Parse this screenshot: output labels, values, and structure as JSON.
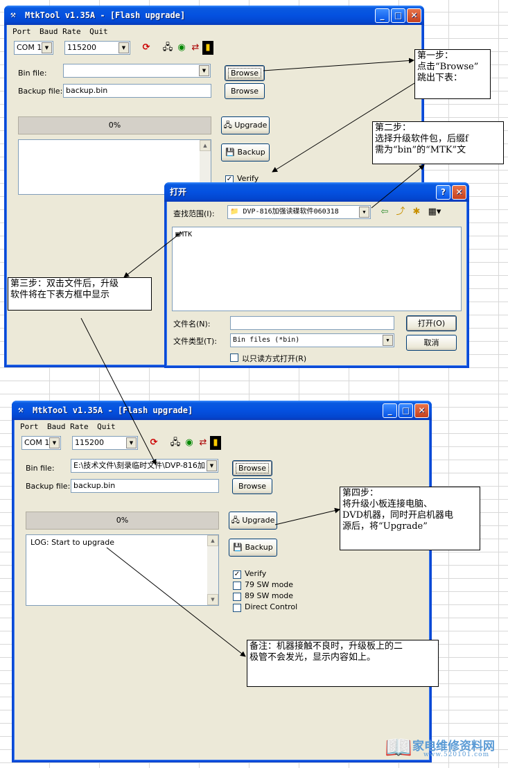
{
  "top_window": {
    "title": "MtkTool v1.35A - [Flash upgrade]",
    "menu": [
      "Port",
      "Baud Rate",
      "Quit"
    ],
    "com_port": "COM 1",
    "baud_rate": "115200",
    "bin_file_label": "Bin file:",
    "bin_file_value": "",
    "backup_file_label": "Backup file:",
    "backup_file_value": "backup.bin",
    "browse_label": "Browse",
    "browse2_label": "Browse",
    "progress": "0%",
    "upgrade_label": "Upgrade",
    "backup_label": "Backup",
    "verify_label": "Verify"
  },
  "open_dialog": {
    "title": "打开",
    "look_in_label": "查找范围(I):",
    "look_in_value": "DVP-816加强读碟软件060318",
    "file_item": "MTK",
    "filename_label": "文件名(N):",
    "filename_value": "",
    "filetype_label": "文件类型(T):",
    "filetype_value": "Bin files (*bin)",
    "readonly_label": "以只读方式打开(R)",
    "open_button": "打开(O)",
    "cancel_button": "取消"
  },
  "bottom_window": {
    "title": "MtkTool v1.35A - [Flash upgrade]",
    "menu": [
      "Port",
      "Baud Rate",
      "Quit"
    ],
    "com_port": "COM 1",
    "baud_rate": "115200",
    "bin_file_label": "Bin file:",
    "bin_file_value": "E:\\技术文件\\刻录临时文件\\DVP-816加",
    "backup_file_label": "Backup file:",
    "backup_file_value": "backup.bin",
    "browse_label": "Browse",
    "browse2_label": "Browse",
    "progress": "0%",
    "log_text": "LOG: Start to upgrade",
    "upgrade_label": "Upgrade",
    "backup_label": "Backup",
    "options": [
      {
        "label": "Verify",
        "checked": true
      },
      {
        "label": "79 SW mode",
        "checked": false
      },
      {
        "label": "89 SW mode",
        "checked": false
      },
      {
        "label": "Direct Control",
        "checked": false
      }
    ]
  },
  "notes": {
    "step1": "第一步：\n点击“Browse”\n跳出下表：",
    "step2": "第二步：\n 选择升级软件包，后缀f\n需为“bin”的“MTK”文",
    "step3": "第三步：双击文件后，升级\n软件将在下表方框中显示",
    "step4": "第四步：\n 将升级小板连接电脑、\nDVD机器，同时开启机器电\n源后，将“Upgrade”",
    "remark": "备注：机器接触不良时，升级板上的二\n极管不会发光，显示内容如上。"
  },
  "watermark": {
    "text": "家电维修资料网",
    "url": "www.520101.com"
  },
  "colors": {
    "titlebar": "#0451e0",
    "window_bg": "#ece9d8",
    "watermark": "#5b9bd5"
  }
}
